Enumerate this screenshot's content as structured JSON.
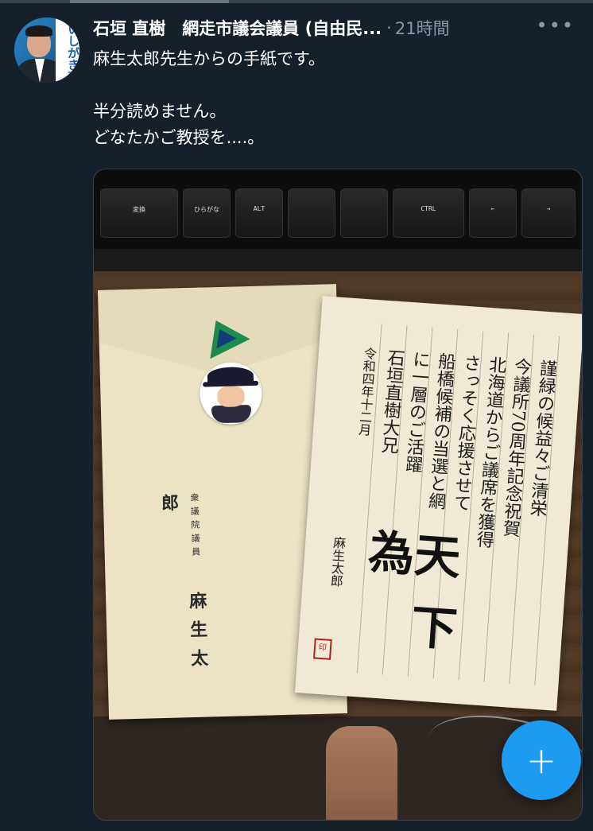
{
  "tweet": {
    "author_name": "石垣 直樹　網走市議会議員 (自由民...",
    "separator": "·",
    "time": "21時間",
    "more": "•••",
    "avatar_banner": "いしがき直",
    "text_line1": "麻生太郎先生からの手紙です。",
    "text_line2": "半分読めません。",
    "text_line3": "どなたかご教授を....。"
  },
  "photo": {
    "keys": [
      "変換",
      "ひらがな",
      "ALT",
      "",
      "CTRL",
      "←",
      "→"
    ],
    "envelope_title": "衆議院議員",
    "envelope_signature": "麻生太郎",
    "letter_columns": [
      "謹緑の候益々ご清栄",
      "今議所70周年記念祝賀",
      "北海道からご議席を獲得",
      "さっそく応援させて頂き",
      "船橋候補の当選と網走",
      "に一層のご活躍を",
      "石垣直樹大兄",
      "令和四年十二月"
    ],
    "letter_big1": "為天",
    "letter_big2": "下",
    "letter_sig": "麻生太郎",
    "stamp": "印"
  },
  "fab": {
    "label": "+"
  },
  "colors": {
    "background": "#15202b",
    "secondary_text": "#8899a6",
    "accent": "#1d9bf0"
  }
}
